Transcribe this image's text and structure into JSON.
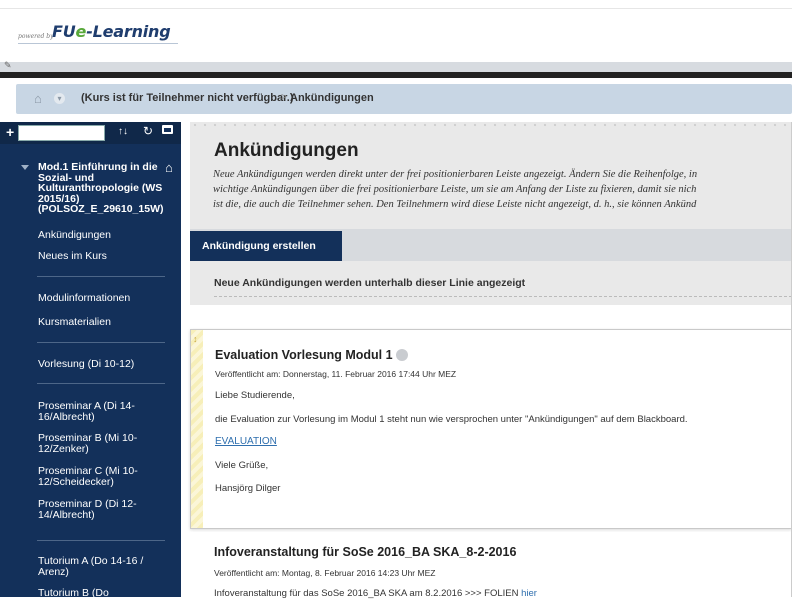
{
  "logo": {
    "powered": "powered by",
    "brand_prefix": "FU",
    "brand_e": "e",
    "brand_suffix": "-Learning"
  },
  "breadcrumb": {
    "items": [
      "(Kurs ist für Teilnehmer nicht verfügbar.)",
      "Ankündigungen"
    ],
    "separator": ">"
  },
  "sidebar": {
    "course_title": "Mod.1 Einführung in die Sozial- und Kulturanthropologie (WS 2015/16) (POLSOZ_E_29610_15W)",
    "groups": [
      [
        "Ankündigungen",
        "Neues im Kurs"
      ],
      [
        "Modulinformationen",
        "Kursmaterialien"
      ],
      [
        "Vorlesung (Di 10-12)"
      ],
      [
        "Proseminar A (Di 14-16/Albrecht)",
        "Proseminar B (Mi 10-12/Zenker)",
        "Proseminar C (Mi 10-12/Scheidecker)",
        "Proseminar D (Di 12-14/Albrecht)"
      ],
      [
        "Tutorium A (Do 14-16 / Arenz)",
        "Tutorium B (Do"
      ]
    ]
  },
  "page": {
    "title": "Ankündigungen",
    "description_lines": [
      "Neue Ankündigungen werden direkt unter der frei positionierbaren Leiste angezeigt. Ändern Sie die Reihenfolge, in",
      "wichtige Ankündigungen über die frei positionierbare Leiste, um sie am Anfang der Liste zu fixieren, damit sie nich",
      "ist die, die auch die Teilnehmer sehen. Den Teilnehmern wird diese Leiste nicht angezeigt, d. h., sie können Ankünd"
    ],
    "create_button": "Ankündigung erstellen",
    "notice": "Neue Ankündigungen werden unterhalb dieser Linie angezeigt"
  },
  "announcements": [
    {
      "title": "Evaluation Vorlesung Modul 1",
      "meta": "Veröffentlicht am: Donnerstag, 11. Februar 2016 17:44 Uhr MEZ",
      "lines": [
        "Liebe Studierende,",
        "die Evaluation zur Vorlesung im Modul 1 steht nun wie versprochen unter \"Ankündigungen\" auf dem Blackboard.",
        "EVALUATION",
        "Viele Grüße,",
        "Hansjörg Dilger"
      ]
    },
    {
      "title": "Infoveranstaltung für SoSe 2016_BA SKA_8-2-2016",
      "meta": "Veröffentlicht am: Montag, 8. Februar 2016 14:23 Uhr MEZ",
      "body_text": "Infoveranstaltung für das SoSe 2016_BA SKA am 8.2.2016 >>> FOLIEN ",
      "body_link": "hier"
    }
  ]
}
